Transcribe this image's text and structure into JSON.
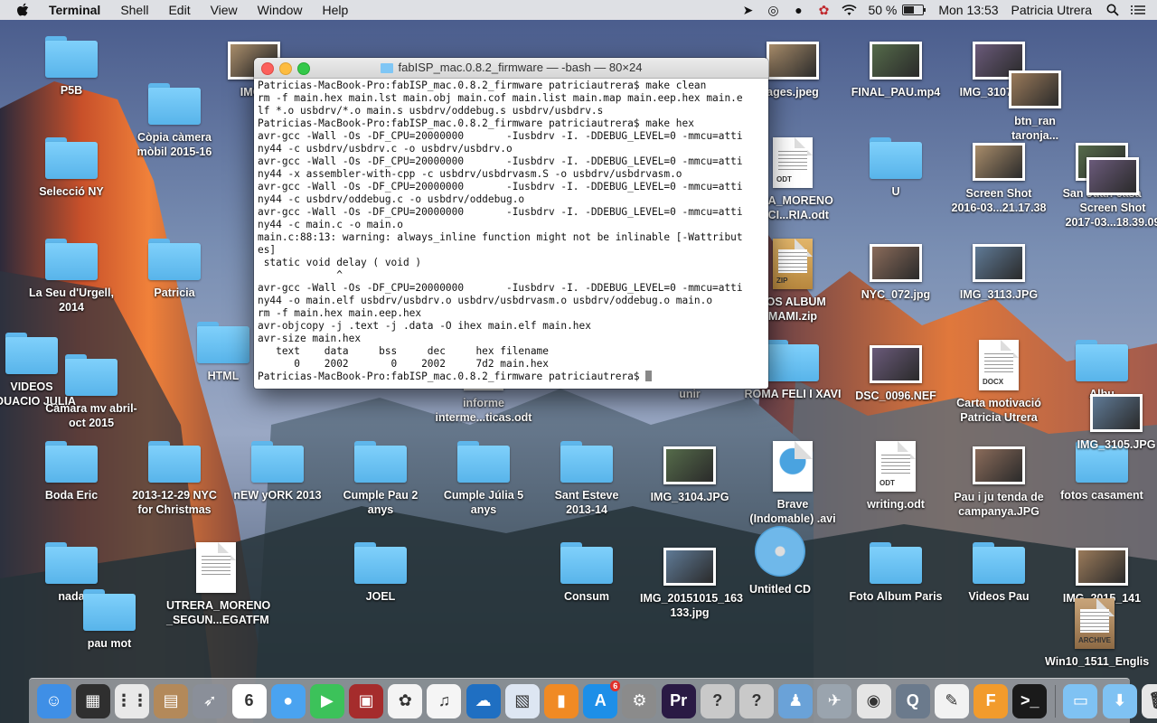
{
  "menubar": {
    "app_name": "Terminal",
    "items": [
      "Shell",
      "Edit",
      "View",
      "Window",
      "Help"
    ],
    "battery": "50 %",
    "clock": "Mon 13:53",
    "user": "Patricia Utrera"
  },
  "terminal": {
    "title": "fabISP_mac.0.8.2_firmware — -bash — 80×24",
    "lines": [
      "Patricias-MacBook-Pro:fabISP_mac.0.8.2_firmware patriciautrera$ make clean",
      "rm -f main.hex main.lst main.obj main.cof main.list main.map main.eep.hex main.e",
      "lf *.o usbdrv/*.o main.s usbdrv/oddebug.s usbdrv/usbdrv.s",
      "Patricias-MacBook-Pro:fabISP_mac.0.8.2_firmware patriciautrera$ make hex",
      "avr-gcc -Wall -Os -DF_CPU=20000000       -Iusbdrv -I. -DDEBUG_LEVEL=0 -mmcu=atti",
      "ny44 -c usbdrv/usbdrv.c -o usbdrv/usbdrv.o",
      "avr-gcc -Wall -Os -DF_CPU=20000000       -Iusbdrv -I. -DDEBUG_LEVEL=0 -mmcu=atti",
      "ny44 -x assembler-with-cpp -c usbdrv/usbdrvasm.S -o usbdrv/usbdrvasm.o",
      "avr-gcc -Wall -Os -DF_CPU=20000000       -Iusbdrv -I. -DDEBUG_LEVEL=0 -mmcu=atti",
      "ny44 -c usbdrv/oddebug.c -o usbdrv/oddebug.o",
      "avr-gcc -Wall -Os -DF_CPU=20000000       -Iusbdrv -I. -DDEBUG_LEVEL=0 -mmcu=atti",
      "ny44 -c main.c -o main.o",
      "main.c:88:13: warning: always_inline function might not be inlinable [-Wattribut",
      "es]",
      " static void delay ( void )",
      "             ^",
      "avr-gcc -Wall -Os -DF_CPU=20000000       -Iusbdrv -I. -DDEBUG_LEVEL=0 -mmcu=atti",
      "ny44 -o main.elf usbdrv/usbdrv.o usbdrv/usbdrvasm.o usbdrv/oddebug.o main.o",
      "rm -f main.hex main.eep.hex",
      "avr-objcopy -j .text -j .data -O ihex main.elf main.hex",
      "avr-size main.hex",
      "   text    data     bss     dec     hex filename",
      "      0    2002       0    2002     7d2 main.hex",
      "Patricias-MacBook-Pro:fabISP_mac.0.8.2_firmware patriciautrera$ "
    ]
  },
  "desktop": {
    "icons": [
      {
        "label": "P5B",
        "kind": "folder",
        "icon": "folder-icon"
      },
      {
        "label": "Còpia càmera\nmòbil 2015-16",
        "kind": "folder",
        "icon": "folder-icon"
      },
      {
        "label": "Selecció NY",
        "kind": "folder",
        "icon": "folder-icon"
      },
      {
        "label": "La Seu d'Urgell,\n2014",
        "kind": "folder",
        "icon": "folder-icon"
      },
      {
        "label": "Patricia",
        "kind": "folder",
        "icon": "folder-icon"
      },
      {
        "label": "VIDEOS\nADUACIO JULIA",
        "kind": "folder",
        "icon": "folder-icon"
      },
      {
        "label": "Càmara mv abril-\noct 2015",
        "kind": "folder",
        "icon": "folder-icon"
      },
      {
        "label": "HTML",
        "kind": "folder",
        "icon": "folder-icon"
      },
      {
        "label": "IMG_",
        "kind": "photo",
        "icon": "image-icon"
      },
      {
        "label": "Boda Eric",
        "kind": "folder",
        "icon": "folder-icon"
      },
      {
        "label": "2013-12-29 NYC\nfor Christmas",
        "kind": "folder",
        "icon": "folder-icon"
      },
      {
        "label": "nEW yORK 2013",
        "kind": "folder",
        "icon": "folder-icon"
      },
      {
        "label": "Cumple Pau 2 anys",
        "kind": "folder",
        "icon": "folder-icon"
      },
      {
        "label": "Cumple Júlia 5\nanys",
        "kind": "folder",
        "icon": "folder-icon"
      },
      {
        "label": "Sant Esteve\n2013-14",
        "kind": "folder",
        "icon": "folder-icon"
      },
      {
        "label": "IMG_3104.JPG",
        "kind": "photo",
        "icon": "image-icon"
      },
      {
        "label": "Brave\n(Indomable) .avi",
        "kind": "video",
        "icon": "quicktime-icon"
      },
      {
        "label": "writing.odt",
        "kind": "doc",
        "icon": "document-icon",
        "tag": "ODT"
      },
      {
        "label": "Pau i ju tenda de\ncampanya.JPG",
        "kind": "photo",
        "icon": "image-icon"
      },
      {
        "label": "fotos casament",
        "kind": "folder",
        "icon": "folder-icon"
      },
      {
        "label": "nada",
        "kind": "folder",
        "icon": "folder-icon"
      },
      {
        "label": "pau mot",
        "kind": "folder",
        "icon": "folder-icon"
      },
      {
        "label": "UTRERA_MORENO\n_SEGUN...EGATFM",
        "kind": "doc",
        "icon": "document-icon",
        "tag": ""
      },
      {
        "label": "JOEL",
        "kind": "folder",
        "icon": "folder-icon"
      },
      {
        "label": "Consum",
        "kind": "folder",
        "icon": "folder-icon"
      },
      {
        "label": "IMG_20151015_163\n133.jpg",
        "kind": "photo",
        "icon": "image-icon"
      },
      {
        "label": "Untitled CD",
        "kind": "cd",
        "icon": "cd-icon"
      },
      {
        "label": "Foto Album Paris",
        "kind": "folder",
        "icon": "folder-icon"
      },
      {
        "label": "Videos Pau",
        "kind": "folder",
        "icon": "folder-icon"
      },
      {
        "label": "IMG_2015_141\ng",
        "kind": "photo",
        "icon": "image-icon"
      },
      {
        "label": "Win10_1511_Englis",
        "kind": "archive",
        "icon": "archive-icon",
        "tag": "ARCHIVE"
      },
      {
        "label": "informe\ninterme...ticas.odt",
        "kind": "doc",
        "icon": "document-icon",
        "tag": "ODT"
      },
      {
        "label": "unir",
        "kind": "folder",
        "icon": "folder-icon"
      },
      {
        "label": "ROMA FELI I XAVI",
        "kind": "folder",
        "icon": "folder-icon"
      },
      {
        "label": "DSC_0096.NEF",
        "kind": "photo",
        "icon": "image-icon"
      },
      {
        "label": "Carta motivació\nPatricia Utrera",
        "kind": "doc",
        "icon": "document-icon",
        "tag": "DOCX"
      },
      {
        "label": "Albu",
        "kind": "folder",
        "icon": "folder-icon"
      },
      {
        "label": "IMG_3105.JPG",
        "kind": "photo",
        "icon": "image-icon"
      },
      {
        "label": "ages.jpeg",
        "kind": "photo",
        "icon": "image-icon"
      },
      {
        "label": "FINAL_PAU.mp4",
        "kind": "photo",
        "icon": "video-icon"
      },
      {
        "label": "IMG_3107.JPG",
        "kind": "photo",
        "icon": "image-icon"
      },
      {
        "label": "btn_ran\ntaronja...",
        "kind": "photo",
        "icon": "image-icon"
      },
      {
        "label": "ERA_MORENO\nRICI...RIA.odt",
        "kind": "doc",
        "icon": "document-icon",
        "tag": "ODT"
      },
      {
        "label": "U",
        "kind": "folder",
        "icon": "folder-icon"
      },
      {
        "label": "Screen Shot\n2016-03...21.17.38",
        "kind": "photo",
        "icon": "image-icon"
      },
      {
        "label": "San Juan casa",
        "kind": "photo",
        "icon": "image-icon"
      },
      {
        "label": "Screen Shot\n2017-03...18.39.09",
        "kind": "photo",
        "icon": "image-icon"
      },
      {
        "label": "TOS ALBUM\nMAMI.zip",
        "kind": "zip",
        "icon": "zip-icon",
        "tag": "ZIP"
      },
      {
        "label": "NYC_072.jpg",
        "kind": "photo",
        "icon": "image-icon"
      },
      {
        "label": "IMG_3113.JPG",
        "kind": "photo",
        "icon": "image-icon"
      }
    ]
  },
  "dock": {
    "items": [
      {
        "name": "finder-icon",
        "color": "#3f8fe6",
        "glyph": "☺"
      },
      {
        "name": "photo-booth-icon",
        "color": "#2f2f2f",
        "glyph": "▦"
      },
      {
        "name": "launchpad-icon",
        "color": "#e9e9e9",
        "glyph": "⋮⋮"
      },
      {
        "name": "contacts-icon",
        "color": "#b3895a",
        "glyph": "▤"
      },
      {
        "name": "rocket-icon",
        "color": "#8a8f99",
        "glyph": "➶"
      },
      {
        "name": "calendar-icon",
        "color": "#ffffff",
        "glyph": "6"
      },
      {
        "name": "messages-icon",
        "color": "#4aa3f0",
        "glyph": "●"
      },
      {
        "name": "facetime-icon",
        "color": "#3cc25a",
        "glyph": "▶"
      },
      {
        "name": "photo-slideshow-icon",
        "color": "#a52c2c",
        "glyph": "▣"
      },
      {
        "name": "photos-icon",
        "color": "#f4f4f4",
        "glyph": "✿"
      },
      {
        "name": "itunes-icon",
        "color": "#f5f5f5",
        "glyph": "♫"
      },
      {
        "name": "openoffice-icon",
        "color": "#1f6fc2",
        "glyph": "☁"
      },
      {
        "name": "preview-icon",
        "color": "#dde6f2",
        "glyph": "▧"
      },
      {
        "name": "ibooks-icon",
        "color": "#f08a24",
        "glyph": "▮"
      },
      {
        "name": "app-store-icon",
        "color": "#1d8fe8",
        "glyph": "A",
        "badge": "6"
      },
      {
        "name": "system-preferences-icon",
        "color": "#8b8b8b",
        "glyph": "⚙"
      },
      {
        "name": "premiere-icon",
        "color": "#2a1a44",
        "glyph": "Pr"
      },
      {
        "name": "unknown-app-icon",
        "color": "#c9c9c9",
        "glyph": "?"
      },
      {
        "name": "unknown-app-icon-2",
        "color": "#c9c9c9",
        "glyph": "?"
      },
      {
        "name": "migration-icon",
        "color": "#6aa2d8",
        "glyph": "♟"
      },
      {
        "name": "network-utility-icon",
        "color": "#9aa4ae",
        "glyph": "✈"
      },
      {
        "name": "chrome-icon",
        "color": "#e5e5e5",
        "glyph": "◉"
      },
      {
        "name": "quicktime-icon",
        "color": "#6b7a8c",
        "glyph": "Q"
      },
      {
        "name": "textedit-icon",
        "color": "#f2f2f2",
        "glyph": "✎"
      },
      {
        "name": "fusion360-icon",
        "color": "#f29b2c",
        "glyph": "F"
      },
      {
        "name": "terminal-icon",
        "color": "#1a1a1a",
        "glyph": ">_"
      },
      {
        "name": "applications-folder-icon",
        "color": "#7fc2f3",
        "glyph": "▭"
      },
      {
        "name": "downloads-folder-icon",
        "color": "#7fc2f3",
        "glyph": "⬇"
      },
      {
        "name": "trash-icon",
        "color": "#e6e6e6",
        "glyph": "🗑"
      }
    ]
  }
}
